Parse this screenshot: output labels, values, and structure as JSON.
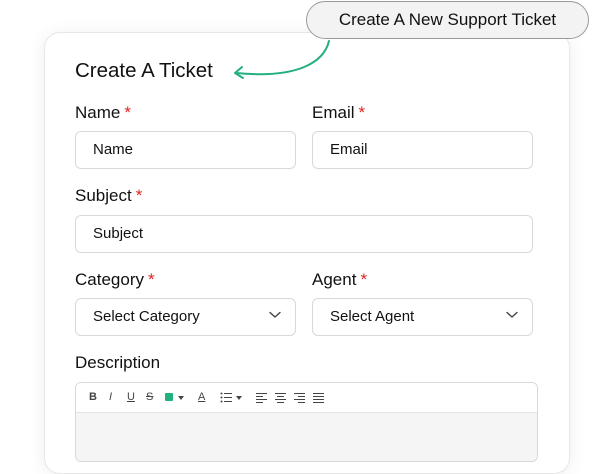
{
  "callout": {
    "text": "Create A New Support Ticket"
  },
  "form": {
    "title": "Create A Ticket",
    "required_marker": "*",
    "name": {
      "label": "Name",
      "placeholder": "Name"
    },
    "email": {
      "label": "Email",
      "placeholder": "Email"
    },
    "subject": {
      "label": "Subject",
      "placeholder": "Subject"
    },
    "category": {
      "label": "Category",
      "value": "Select Category"
    },
    "agent": {
      "label": "Agent",
      "value": "Select Agent"
    },
    "description": {
      "label": "Description"
    }
  },
  "toolbar": {
    "bold": "B",
    "italic": "I",
    "underline": "U",
    "strike": "S",
    "font_color": "A",
    "icons": [
      "bold-icon",
      "italic-icon",
      "underline-icon",
      "strikethrough-icon",
      "highlight-color-icon",
      "font-color-icon",
      "list-icon",
      "align-left-icon",
      "align-center-icon",
      "align-right-icon",
      "align-justify-icon"
    ]
  },
  "colors": {
    "accent": "#22b07d",
    "required": "#e0231d",
    "highlight_swatch": "#22b07d"
  }
}
